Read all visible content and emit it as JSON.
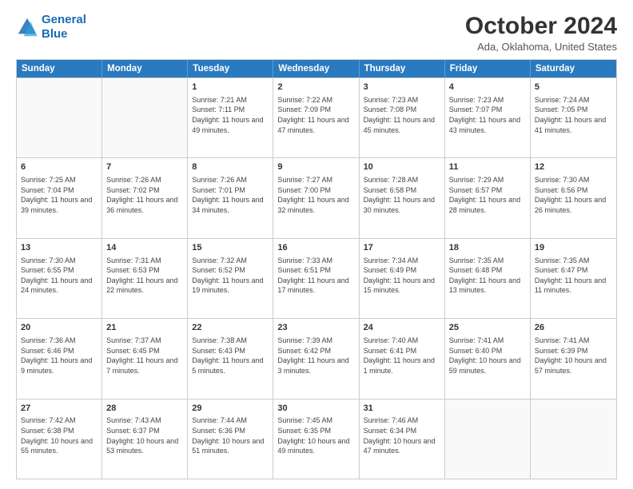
{
  "logo": {
    "line1": "General",
    "line2": "Blue"
  },
  "title": "October 2024",
  "subtitle": "Ada, Oklahoma, United States",
  "header_days": [
    "Sunday",
    "Monday",
    "Tuesday",
    "Wednesday",
    "Thursday",
    "Friday",
    "Saturday"
  ],
  "weeks": [
    [
      {
        "day": "",
        "sunrise": "",
        "sunset": "",
        "daylight": ""
      },
      {
        "day": "",
        "sunrise": "",
        "sunset": "",
        "daylight": ""
      },
      {
        "day": "1",
        "sunrise": "Sunrise: 7:21 AM",
        "sunset": "Sunset: 7:11 PM",
        "daylight": "Daylight: 11 hours and 49 minutes."
      },
      {
        "day": "2",
        "sunrise": "Sunrise: 7:22 AM",
        "sunset": "Sunset: 7:09 PM",
        "daylight": "Daylight: 11 hours and 47 minutes."
      },
      {
        "day": "3",
        "sunrise": "Sunrise: 7:23 AM",
        "sunset": "Sunset: 7:08 PM",
        "daylight": "Daylight: 11 hours and 45 minutes."
      },
      {
        "day": "4",
        "sunrise": "Sunrise: 7:23 AM",
        "sunset": "Sunset: 7:07 PM",
        "daylight": "Daylight: 11 hours and 43 minutes."
      },
      {
        "day": "5",
        "sunrise": "Sunrise: 7:24 AM",
        "sunset": "Sunset: 7:05 PM",
        "daylight": "Daylight: 11 hours and 41 minutes."
      }
    ],
    [
      {
        "day": "6",
        "sunrise": "Sunrise: 7:25 AM",
        "sunset": "Sunset: 7:04 PM",
        "daylight": "Daylight: 11 hours and 39 minutes."
      },
      {
        "day": "7",
        "sunrise": "Sunrise: 7:26 AM",
        "sunset": "Sunset: 7:02 PM",
        "daylight": "Daylight: 11 hours and 36 minutes."
      },
      {
        "day": "8",
        "sunrise": "Sunrise: 7:26 AM",
        "sunset": "Sunset: 7:01 PM",
        "daylight": "Daylight: 11 hours and 34 minutes."
      },
      {
        "day": "9",
        "sunrise": "Sunrise: 7:27 AM",
        "sunset": "Sunset: 7:00 PM",
        "daylight": "Daylight: 11 hours and 32 minutes."
      },
      {
        "day": "10",
        "sunrise": "Sunrise: 7:28 AM",
        "sunset": "Sunset: 6:58 PM",
        "daylight": "Daylight: 11 hours and 30 minutes."
      },
      {
        "day": "11",
        "sunrise": "Sunrise: 7:29 AM",
        "sunset": "Sunset: 6:57 PM",
        "daylight": "Daylight: 11 hours and 28 minutes."
      },
      {
        "day": "12",
        "sunrise": "Sunrise: 7:30 AM",
        "sunset": "Sunset: 6:56 PM",
        "daylight": "Daylight: 11 hours and 26 minutes."
      }
    ],
    [
      {
        "day": "13",
        "sunrise": "Sunrise: 7:30 AM",
        "sunset": "Sunset: 6:55 PM",
        "daylight": "Daylight: 11 hours and 24 minutes."
      },
      {
        "day": "14",
        "sunrise": "Sunrise: 7:31 AM",
        "sunset": "Sunset: 6:53 PM",
        "daylight": "Daylight: 11 hours and 22 minutes."
      },
      {
        "day": "15",
        "sunrise": "Sunrise: 7:32 AM",
        "sunset": "Sunset: 6:52 PM",
        "daylight": "Daylight: 11 hours and 19 minutes."
      },
      {
        "day": "16",
        "sunrise": "Sunrise: 7:33 AM",
        "sunset": "Sunset: 6:51 PM",
        "daylight": "Daylight: 11 hours and 17 minutes."
      },
      {
        "day": "17",
        "sunrise": "Sunrise: 7:34 AM",
        "sunset": "Sunset: 6:49 PM",
        "daylight": "Daylight: 11 hours and 15 minutes."
      },
      {
        "day": "18",
        "sunrise": "Sunrise: 7:35 AM",
        "sunset": "Sunset: 6:48 PM",
        "daylight": "Daylight: 11 hours and 13 minutes."
      },
      {
        "day": "19",
        "sunrise": "Sunrise: 7:35 AM",
        "sunset": "Sunset: 6:47 PM",
        "daylight": "Daylight: 11 hours and 11 minutes."
      }
    ],
    [
      {
        "day": "20",
        "sunrise": "Sunrise: 7:36 AM",
        "sunset": "Sunset: 6:46 PM",
        "daylight": "Daylight: 11 hours and 9 minutes."
      },
      {
        "day": "21",
        "sunrise": "Sunrise: 7:37 AM",
        "sunset": "Sunset: 6:45 PM",
        "daylight": "Daylight: 11 hours and 7 minutes."
      },
      {
        "day": "22",
        "sunrise": "Sunrise: 7:38 AM",
        "sunset": "Sunset: 6:43 PM",
        "daylight": "Daylight: 11 hours and 5 minutes."
      },
      {
        "day": "23",
        "sunrise": "Sunrise: 7:39 AM",
        "sunset": "Sunset: 6:42 PM",
        "daylight": "Daylight: 11 hours and 3 minutes."
      },
      {
        "day": "24",
        "sunrise": "Sunrise: 7:40 AM",
        "sunset": "Sunset: 6:41 PM",
        "daylight": "Daylight: 11 hours and 1 minute."
      },
      {
        "day": "25",
        "sunrise": "Sunrise: 7:41 AM",
        "sunset": "Sunset: 6:40 PM",
        "daylight": "Daylight: 10 hours and 59 minutes."
      },
      {
        "day": "26",
        "sunrise": "Sunrise: 7:41 AM",
        "sunset": "Sunset: 6:39 PM",
        "daylight": "Daylight: 10 hours and 57 minutes."
      }
    ],
    [
      {
        "day": "27",
        "sunrise": "Sunrise: 7:42 AM",
        "sunset": "Sunset: 6:38 PM",
        "daylight": "Daylight: 10 hours and 55 minutes."
      },
      {
        "day": "28",
        "sunrise": "Sunrise: 7:43 AM",
        "sunset": "Sunset: 6:37 PM",
        "daylight": "Daylight: 10 hours and 53 minutes."
      },
      {
        "day": "29",
        "sunrise": "Sunrise: 7:44 AM",
        "sunset": "Sunset: 6:36 PM",
        "daylight": "Daylight: 10 hours and 51 minutes."
      },
      {
        "day": "30",
        "sunrise": "Sunrise: 7:45 AM",
        "sunset": "Sunset: 6:35 PM",
        "daylight": "Daylight: 10 hours and 49 minutes."
      },
      {
        "day": "31",
        "sunrise": "Sunrise: 7:46 AM",
        "sunset": "Sunset: 6:34 PM",
        "daylight": "Daylight: 10 hours and 47 minutes."
      },
      {
        "day": "",
        "sunrise": "",
        "sunset": "",
        "daylight": ""
      },
      {
        "day": "",
        "sunrise": "",
        "sunset": "",
        "daylight": ""
      }
    ]
  ]
}
